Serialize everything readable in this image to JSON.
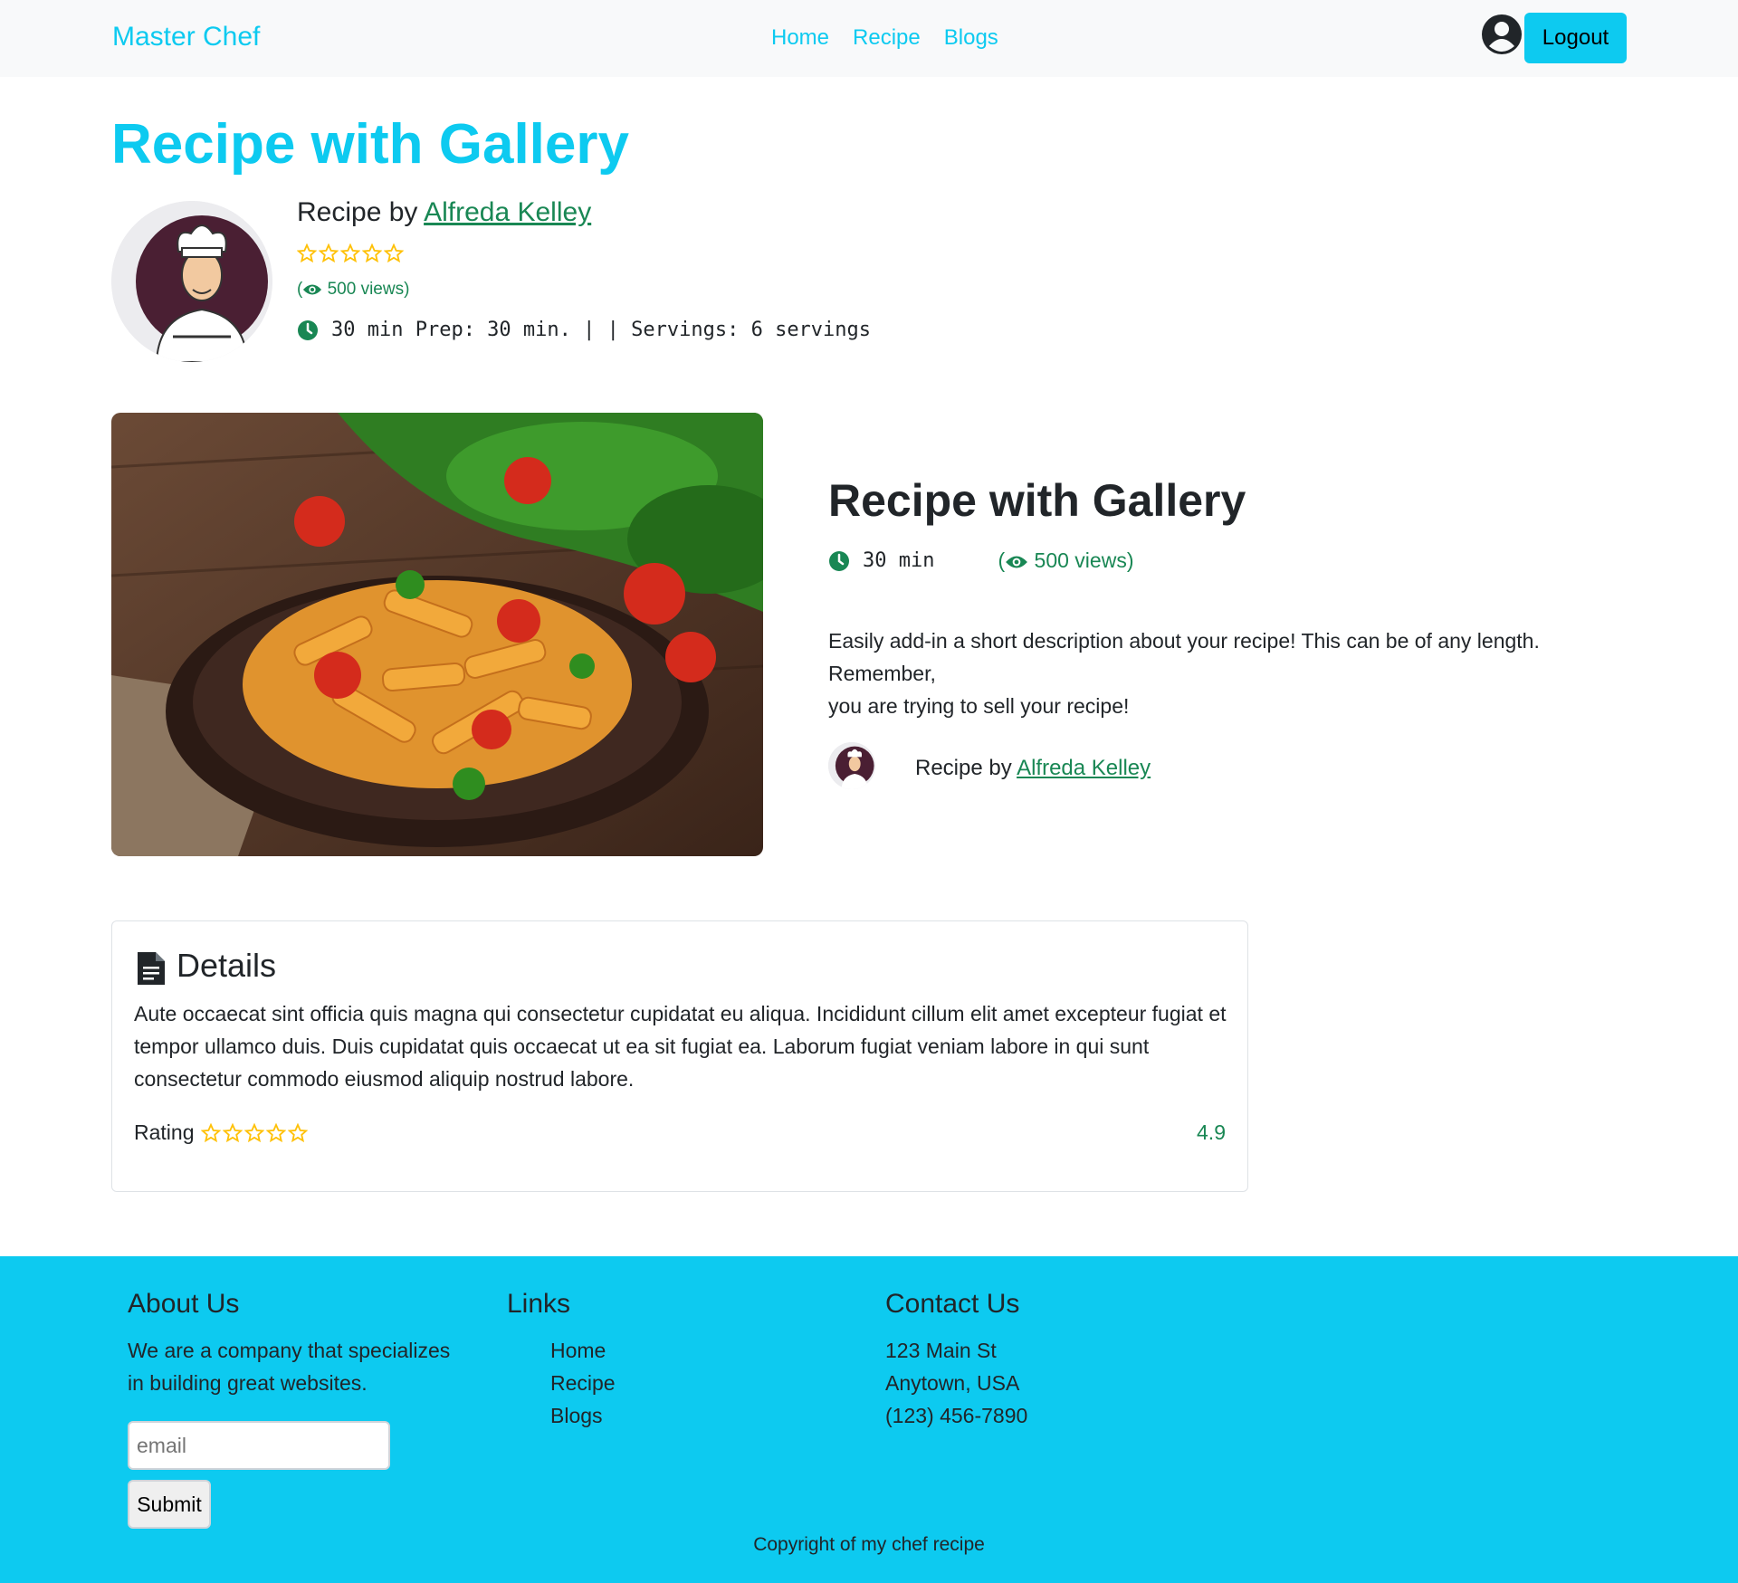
{
  "nav": {
    "brand": "Master Chef",
    "links": [
      "Home",
      "Recipe",
      "Blogs"
    ],
    "logout": "Logout"
  },
  "header": {
    "title": "Recipe with Gallery",
    "recipe_by": "Recipe by ",
    "author": "Alfreda Kelley",
    "views": "500 views)",
    "views_open": "(",
    "meta": "30 min Prep: 30 min. | | Servings: 6 servings"
  },
  "hero": {
    "title": "Recipe with Gallery",
    "time": "30 min",
    "views_open": "(",
    "views": "500 views)",
    "description_line1": "Easily add-in a short description about your recipe! This can be of any length. Remember,",
    "description_line2": "you are trying to sell your recipe!",
    "recipe_by": "Recipe by ",
    "author": "Alfreda Kelley"
  },
  "details": {
    "title": "Details",
    "text": "Aute occaecat sint officia quis magna qui consectetur cupidatat eu aliqua. Incididunt cillum elit amet excepteur fugiat et tempor ullamco duis. Duis cupidatat quis occaecat ut ea sit fugiat ea. Laborum fugiat veniam labore in qui sunt consectetur commodo eiusmod aliquip nostrud labore.",
    "rating_label": "Rating",
    "rating_value": "4.9"
  },
  "footer": {
    "about_title": "About Us",
    "about_text": "We are a company that specializes in building great websites.",
    "email_placeholder": "email",
    "submit": "Submit",
    "links_title": "Links",
    "links": [
      "Home",
      "Recipe",
      "Blogs"
    ],
    "contact_title": "Contact Us",
    "address1": "123 Main St",
    "address2": "Anytown, USA",
    "phone": "(123) 456-7890",
    "copyright": "Copyright of my chef recipe"
  },
  "colors": {
    "accent": "#0dcaf0",
    "link_green": "#198754",
    "star": "#ffc107"
  }
}
